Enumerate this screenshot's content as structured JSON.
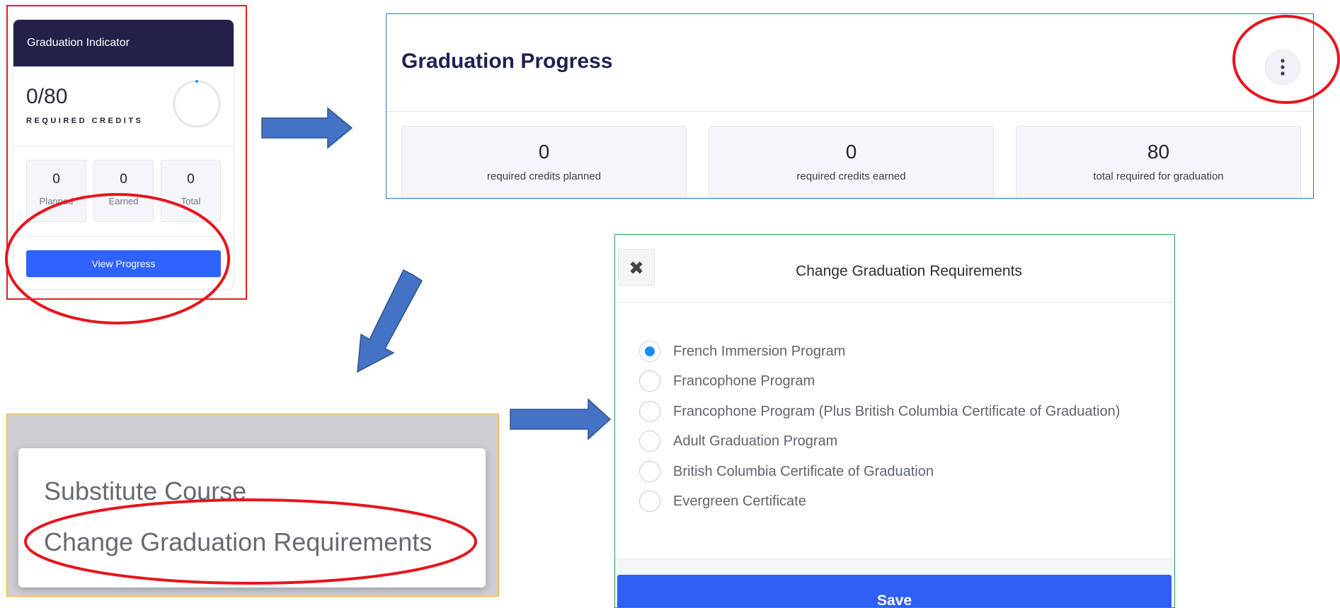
{
  "indicator": {
    "header": "Graduation Indicator",
    "fraction": "0/80",
    "required_label": "REQUIRED CREDITS",
    "progress": 0,
    "boxes": [
      {
        "value": "0",
        "label": "Planned"
      },
      {
        "value": "0",
        "label": "Earned"
      },
      {
        "value": "0",
        "label": "Total"
      }
    ],
    "button_label": "View Progress",
    "colors": {
      "header_bg": "#21214a",
      "button": "#2f62ff",
      "ring_accent": "#2196f3"
    }
  },
  "progress": {
    "title": "Graduation Progress",
    "more_icon": "vertical-ellipsis-icon",
    "stats": [
      {
        "value": "0",
        "label": "required credits planned"
      },
      {
        "value": "0",
        "label": "required credits earned"
      },
      {
        "value": "80",
        "label": "total required for graduation"
      }
    ]
  },
  "menu": {
    "items": [
      "Substitute Course",
      "Change Graduation Requirements"
    ]
  },
  "modal": {
    "title": "Change Graduation Requirements",
    "close_icon": "close-icon",
    "selected_index": 0,
    "options": [
      "French Immersion Program",
      "Francophone Program",
      "Francophone Program (Plus British Columbia Certificate of Graduation)",
      "Adult Graduation Program",
      "British Columbia Certificate of Graduation",
      "Evergreen Certificate"
    ],
    "save_label": "Save",
    "colors": {
      "save": "#2f5ff5",
      "radio_selected": "#1a8cff"
    }
  },
  "annotations": {
    "arrow_color": "#4472c4",
    "highlight_color": "#e8141c"
  }
}
